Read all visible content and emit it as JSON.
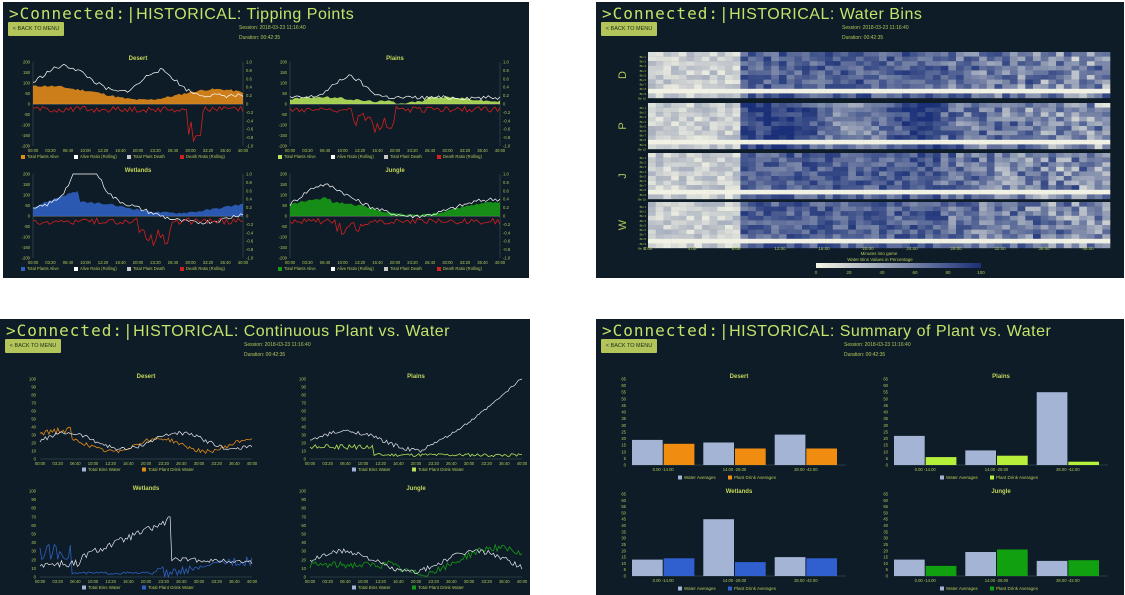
{
  "colors": {
    "bg": "#0d1c26",
    "accent": "#c5e26a",
    "button": "#b3c55a",
    "title": "#c5d65a",
    "axis": "#b3c55a",
    "water": "#a4b4d4",
    "red": "#d42020"
  },
  "panels": {
    "tipping": {
      "title_prefix": ">Connected:",
      "title_bar": "|",
      "title_text": "HISTORICAL:  Tipping Points",
      "back_label": "< BACK TO MENU",
      "session": "Session: 2018-03-23 11:16:40",
      "duration": "Duration: 00:42:35",
      "left_ticks": [
        "200",
        "150",
        "100",
        "50",
        "0",
        "-50",
        "-100",
        "-150",
        "-200"
      ],
      "right_ticks": [
        "1.0",
        "0.8",
        "0.6",
        "0.4",
        "0.2",
        "0",
        "-0.2",
        "-0.4",
        "-0.6",
        "-0.8",
        "-1.0"
      ],
      "x_ticks": [
        "00:00",
        "03:20",
        "06:40",
        "10:00",
        "13:20",
        "16:40",
        "20:00",
        "23:20",
        "26:40",
        "30:00",
        "33:20",
        "36:40",
        "40:00"
      ],
      "legend": [
        "Total Plants Alive",
        "Alive Ratio (Rolling)",
        "Total Plant Death",
        "Death Ratio (Rolling)"
      ],
      "biomes": [
        {
          "name": "Desert",
          "color": "#e08a1a"
        },
        {
          "name": "Plains",
          "color": "#b6e35a"
        },
        {
          "name": "Wetlands",
          "color": "#2f5fc0"
        },
        {
          "name": "Jungle",
          "color": "#169a16"
        }
      ]
    },
    "waterbins": {
      "title_prefix": ">Connected:",
      "title_bar": "|",
      "title_text": "HISTORICAL:  Water Bins",
      "back_label": "< BACK TO MENU",
      "session": "Session: 2018-03-23 11:16:40",
      "duration": "Duration: 00:42:35",
      "rows": [
        "D",
        "P",
        "J",
        "W"
      ],
      "bin_labels": [
        "Bin 1",
        "Bin 2",
        "Bin 3",
        "Bin 4",
        "Bin 5",
        "Bin 6",
        "Bin 7",
        "Bin 8",
        "Bin 9",
        "Bin 10"
      ],
      "x_ticks": [
        "0:00",
        "4:00",
        "8:00",
        "12:00",
        "16:00",
        "20:00",
        "24:00",
        "28:00",
        "32:00",
        "36:00",
        "40:00"
      ],
      "xlabel": "Minutes into game",
      "colorbar_title": "Water Bins Values in Percentage",
      "colorbar_ticks": [
        "0",
        "20",
        "40",
        "60",
        "80",
        "100"
      ]
    },
    "continuous": {
      "title_prefix": ">Connected:",
      "title_bar": "|",
      "title_text": "HISTORICAL:  Continuous Plant vs. Water",
      "back_label": "< BACK TO MENU",
      "session": "Session: 2018-03-23 11:16:40",
      "duration": "Duration: 00:42:35",
      "y_ticks": [
        "100",
        "90",
        "80",
        "70",
        "60",
        "50",
        "40",
        "30",
        "20",
        "10",
        "0"
      ],
      "x_ticks": [
        "00:00",
        "03:20",
        "06:40",
        "10:00",
        "13:20",
        "16:40",
        "20:00",
        "23:20",
        "26:40",
        "30:00",
        "33:20",
        "36:40",
        "40:00"
      ],
      "legend_water": "Total Bins Water",
      "legend_drink": "Total Plant Drink Water",
      "biomes": [
        {
          "name": "Desert",
          "color": "#e08a1a"
        },
        {
          "name": "Plains",
          "color": "#b6e35a"
        },
        {
          "name": "Wetlands",
          "color": "#2f5fc0"
        },
        {
          "name": "Jungle",
          "color": "#169a16"
        }
      ]
    },
    "summary": {
      "title_prefix": ">Connected:",
      "title_bar": "|",
      "title_text": "HISTORICAL: Summary of Plant vs. Water",
      "back_label": "< BACK TO MENU",
      "session": "Session: 2018-03-23 11:16:40",
      "duration": "Duration: 00:42:35",
      "y_ticks": [
        "60",
        "55",
        "50",
        "45",
        "40",
        "35",
        "30",
        "25",
        "20",
        "15",
        "10",
        "5",
        "0"
      ],
      "legend_water": "Water Averages",
      "legend_drink": "Plant Drink Averages",
      "categories": [
        "0.00 -14.00",
        "14.00 -28.00",
        "28.00 -42.00"
      ]
    }
  },
  "chart_data": [
    {
      "type": "bar",
      "title": "Desert",
      "categories": [
        "0.00 -14.00",
        "14.00 -28.00",
        "28.00 -42.00"
      ],
      "ylim": [
        0,
        65
      ],
      "series": [
        {
          "name": "Water Averages",
          "values": [
            19,
            17,
            23
          ],
          "color": "#a4b4d4"
        },
        {
          "name": "Plant Drink Averages",
          "values": [
            16,
            12.5,
            12.5
          ],
          "color": "#f08c10"
        }
      ]
    },
    {
      "type": "bar",
      "title": "Plains",
      "categories": [
        "0.00 -14.00",
        "14.00 -28.00",
        "28.00 -42.00"
      ],
      "ylim": [
        0,
        65
      ],
      "series": [
        {
          "name": "Water Averages",
          "values": [
            22,
            11,
            55
          ],
          "color": "#a4b4d4"
        },
        {
          "name": "Plant Drink Averages",
          "values": [
            6,
            7,
            2.5
          ],
          "color": "#b6f03a"
        }
      ]
    },
    {
      "type": "bar",
      "title": "Wetlands",
      "categories": [
        "0.00 -14.00",
        "14.00 -28.00",
        "28.00 -42.00"
      ],
      "ylim": [
        0,
        65
      ],
      "series": [
        {
          "name": "Water Averages",
          "values": [
            13,
            45,
            15
          ],
          "color": "#a4b4d4"
        },
        {
          "name": "Plant Drink Averages",
          "values": [
            14,
            11,
            14
          ],
          "color": "#3060d0"
        }
      ]
    },
    {
      "type": "bar",
      "title": "Jungle",
      "categories": [
        "0.00 -14.00",
        "14.00 -28.00",
        "28.00 -42.00"
      ],
      "ylim": [
        0,
        65
      ],
      "series": [
        {
          "name": "Water Averages",
          "values": [
            13,
            19,
            12
          ],
          "color": "#a4b4d4"
        },
        {
          "name": "Plant Drink Averages",
          "values": [
            8,
            21,
            12.5
          ],
          "color": "#10a010"
        }
      ]
    }
  ]
}
